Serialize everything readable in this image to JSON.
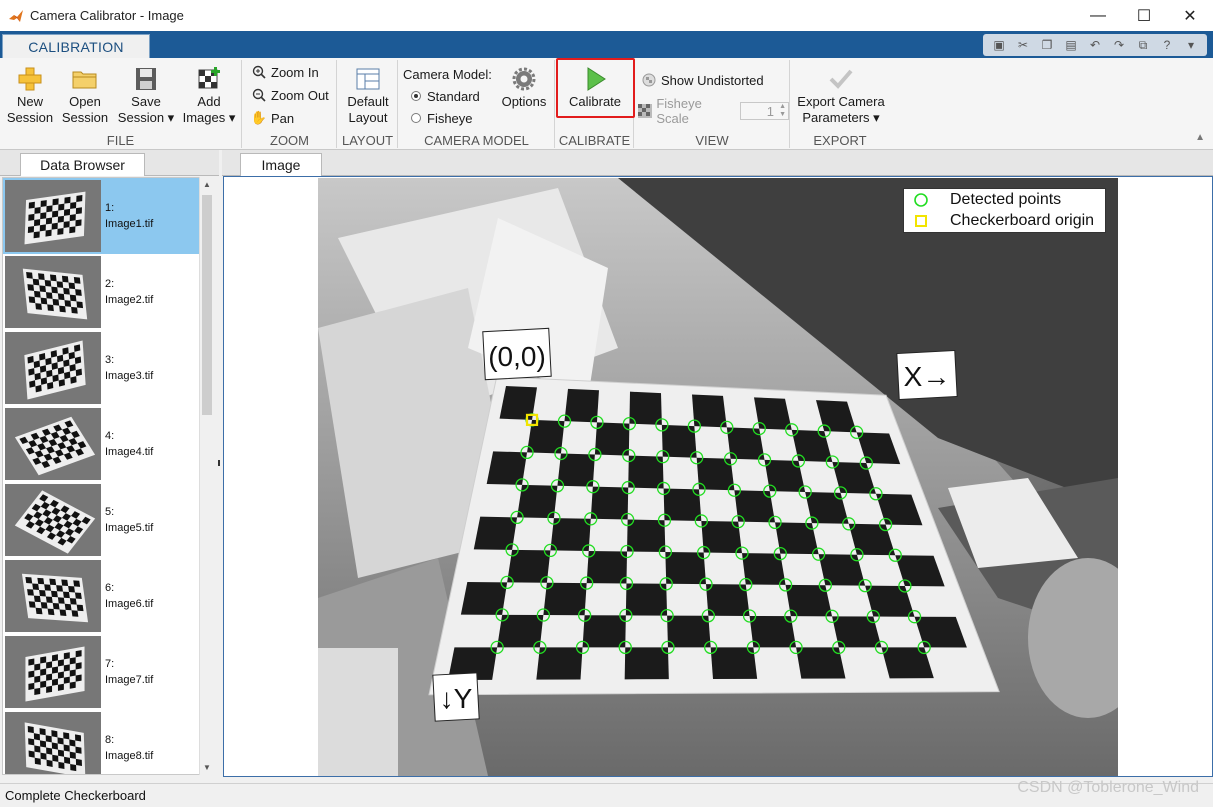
{
  "window": {
    "title": "Camera Calibrator - Image",
    "minimize": "—",
    "maximize": "☐",
    "close": "✕"
  },
  "ribbon": {
    "tab": "CALIBRATION",
    "file": {
      "label": "FILE",
      "new_session": [
        "New",
        "Session"
      ],
      "open_session": [
        "Open",
        "Session"
      ],
      "save_session": [
        "Save",
        "Session ▾"
      ],
      "add_images": [
        "Add",
        "Images ▾"
      ]
    },
    "zoom": {
      "label": "ZOOM",
      "zoom_in": "Zoom In",
      "zoom_out": "Zoom Out",
      "pan": "Pan"
    },
    "layout": {
      "label": "LAYOUT",
      "default_layout": [
        "Default",
        "Layout"
      ]
    },
    "camera_model": {
      "label": "CAMERA MODEL",
      "heading": "Camera Model:",
      "standard": "Standard",
      "fisheye": "Fisheye",
      "options": "Options",
      "selected": "Standard"
    },
    "calibrate": {
      "label": "CALIBRATE",
      "button": "Calibrate"
    },
    "view": {
      "label": "VIEW",
      "show_undistorted": "Show Undistorted",
      "fisheye_scale": "Fisheye Scale",
      "fisheye_scale_value": "1"
    },
    "export": {
      "label": "EXPORT",
      "export_camera": [
        "Export Camera",
        "Parameters ▾"
      ]
    }
  },
  "data_browser": {
    "tab": "Data Browser",
    "items": [
      {
        "index": "1:",
        "file": "Image1.tif",
        "selected": true
      },
      {
        "index": "2:",
        "file": "Image2.tif",
        "selected": false
      },
      {
        "index": "3:",
        "file": "Image3.tif",
        "selected": false
      },
      {
        "index": "4:",
        "file": "Image4.tif",
        "selected": false
      },
      {
        "index": "5:",
        "file": "Image5.tif",
        "selected": false
      },
      {
        "index": "6:",
        "file": "Image6.tif",
        "selected": false
      },
      {
        "index": "7:",
        "file": "Image7.tif",
        "selected": false
      },
      {
        "index": "8:",
        "file": "Image8.tif",
        "selected": false
      }
    ]
  },
  "image_panel": {
    "tab": "Image",
    "annotations": {
      "origin": "(0,0)",
      "x_axis": "X→",
      "y_axis": "↓Y"
    },
    "legend": {
      "detected": "Detected points",
      "origin": "Checkerboard origin"
    }
  },
  "status": {
    "text": "Complete Checkerboard"
  },
  "watermark": "CSDN @Toblerone_Wind",
  "colors": {
    "tab_strip": "#1c5a96",
    "detected_point": "#22dd22",
    "origin_marker": "#f2e400",
    "selected_row": "#8cc8ef",
    "calibrate_highlight": "#e21c1c"
  }
}
